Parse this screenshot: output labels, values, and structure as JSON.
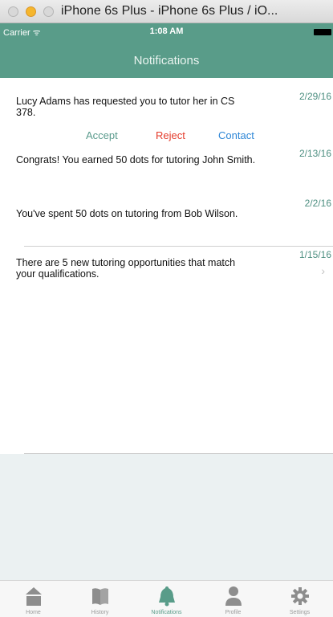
{
  "window": {
    "title": "iPhone 6s Plus - iPhone 6s Plus / iO..."
  },
  "status_bar": {
    "carrier": "Carrier ᯤ",
    "time": "1:08 AM"
  },
  "nav": {
    "title": "Notifications"
  },
  "notifications": [
    {
      "message": "Lucy Adams has requested you to tutor her in CS 378.",
      "date": "2/29/16",
      "actions": {
        "accept": "Accept",
        "reject": "Reject",
        "contact": "Contact"
      }
    },
    {
      "message": "Congrats! You earned 50 dots for tutoring John Smith.",
      "date": "2/13/16"
    },
    {
      "message": "You've spent 50 dots on tutoring from Bob Wilson.",
      "date": "2/2/16"
    },
    {
      "message": "There are 5 new tutoring opportunities that match your qualifications.",
      "date": "1/15/16",
      "chevron": "›"
    }
  ],
  "tabs": [
    {
      "label": "Home",
      "icon": "home-icon"
    },
    {
      "label": "History",
      "icon": "book-icon"
    },
    {
      "label": "Notifications",
      "icon": "bell-icon",
      "active": true
    },
    {
      "label": "Profile",
      "icon": "person-icon"
    },
    {
      "label": "Settings",
      "icon": "gear-icon"
    }
  ],
  "colors": {
    "accent": "#599c89",
    "accept": "#5a9b8d",
    "reject": "#e43b2b",
    "contact": "#2d86d6",
    "date": "#4d8f81"
  }
}
